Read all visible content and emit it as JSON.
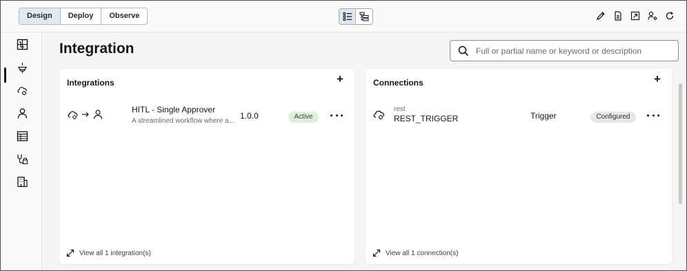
{
  "topbar": {
    "modes": [
      {
        "label": "Design",
        "active": true
      },
      {
        "label": "Deploy",
        "active": false
      },
      {
        "label": "Observe",
        "active": false
      }
    ],
    "view_toggles": [
      {
        "icon": "list-view-icon",
        "active": true
      },
      {
        "icon": "tree-view-icon",
        "active": false
      }
    ],
    "tools": [
      "edit-icon",
      "document-icon",
      "export-icon",
      "user-settings-icon",
      "refresh-icon"
    ]
  },
  "leftnav": {
    "items": [
      "integrations-nav-icon",
      "connections-nav-icon",
      "lookups-nav-icon",
      "users-nav-icon",
      "tables-nav-icon",
      "agents-nav-icon",
      "enterprise-nav-icon"
    ]
  },
  "main": {
    "title": "Integration",
    "search": {
      "placeholder": "Full or partial name or keyword or description",
      "value": ""
    }
  },
  "integrations_card": {
    "title": "Integrations",
    "add_label": "+",
    "row": {
      "name": "HITL - Single Approver",
      "description": "A streamlined workflow where a...",
      "version": "1.0.0",
      "status": "Active"
    },
    "footer": "View all 1 integration(s)"
  },
  "connections_card": {
    "title": "Connections",
    "add_label": "+",
    "row": {
      "type": "rest",
      "name": "REST_TRIGGER",
      "role": "Trigger",
      "status": "Configured"
    },
    "footer": "View all 1 connection(s)"
  },
  "colors": {
    "accent": "#deebf5",
    "active_badge": "#dfeedd",
    "configured_badge": "#e8e7e5"
  }
}
